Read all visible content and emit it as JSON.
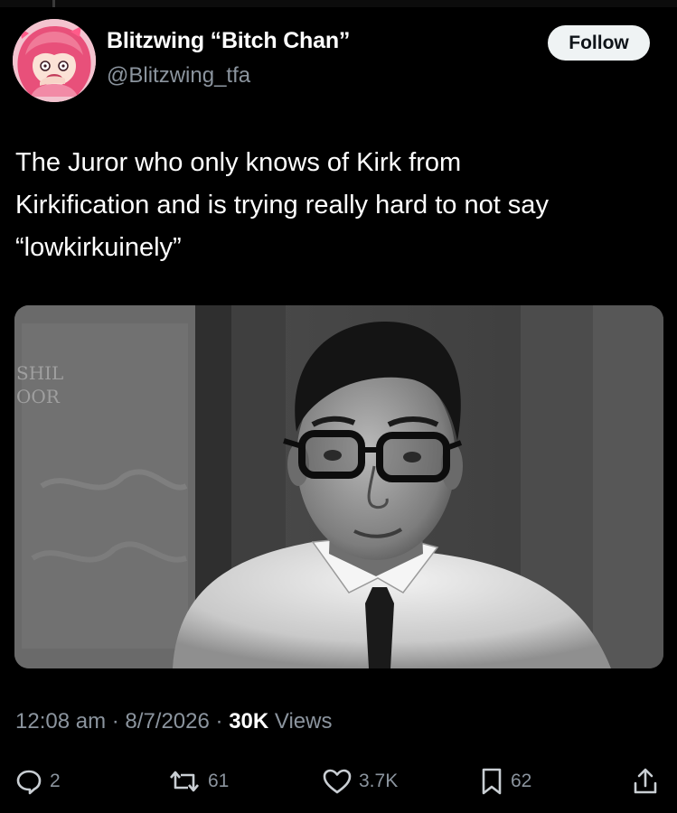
{
  "post": {
    "author": {
      "display_name": "Blitzwing “Bitch Chan”",
      "handle": "@Blitzwing_tfa",
      "avatar": "anime-avatar-pink-hair"
    },
    "follow_label": "Follow",
    "text_lines": [
      "The Juror who only knows of Kirk from",
      "Kirkification and is trying really hard to not say",
      "“lowkirkuinely”"
    ],
    "media": {
      "type": "black-and-white photo",
      "sign_lines": [
        "SHIL",
        "OOR"
      ]
    },
    "meta": {
      "time": "12:08 am",
      "separator": "·",
      "date": "8/7/2026",
      "views_count": "30K",
      "views_label": "Views"
    },
    "actions": {
      "reply": {
        "icon": "reply-icon",
        "count": "2"
      },
      "repost": {
        "icon": "repost-icon",
        "count": "61"
      },
      "like": {
        "icon": "heart-icon",
        "count": "3.7K"
      },
      "bookmark": {
        "icon": "bookmark-icon",
        "count": "62"
      },
      "share": {
        "icon": "share-icon"
      }
    }
  },
  "colors": {
    "background": "#000000",
    "text_primary": "#ffffff",
    "text_secondary": "#8b949e",
    "follow_button_bg": "#eff3f4",
    "follow_button_text": "#0f1419"
  }
}
